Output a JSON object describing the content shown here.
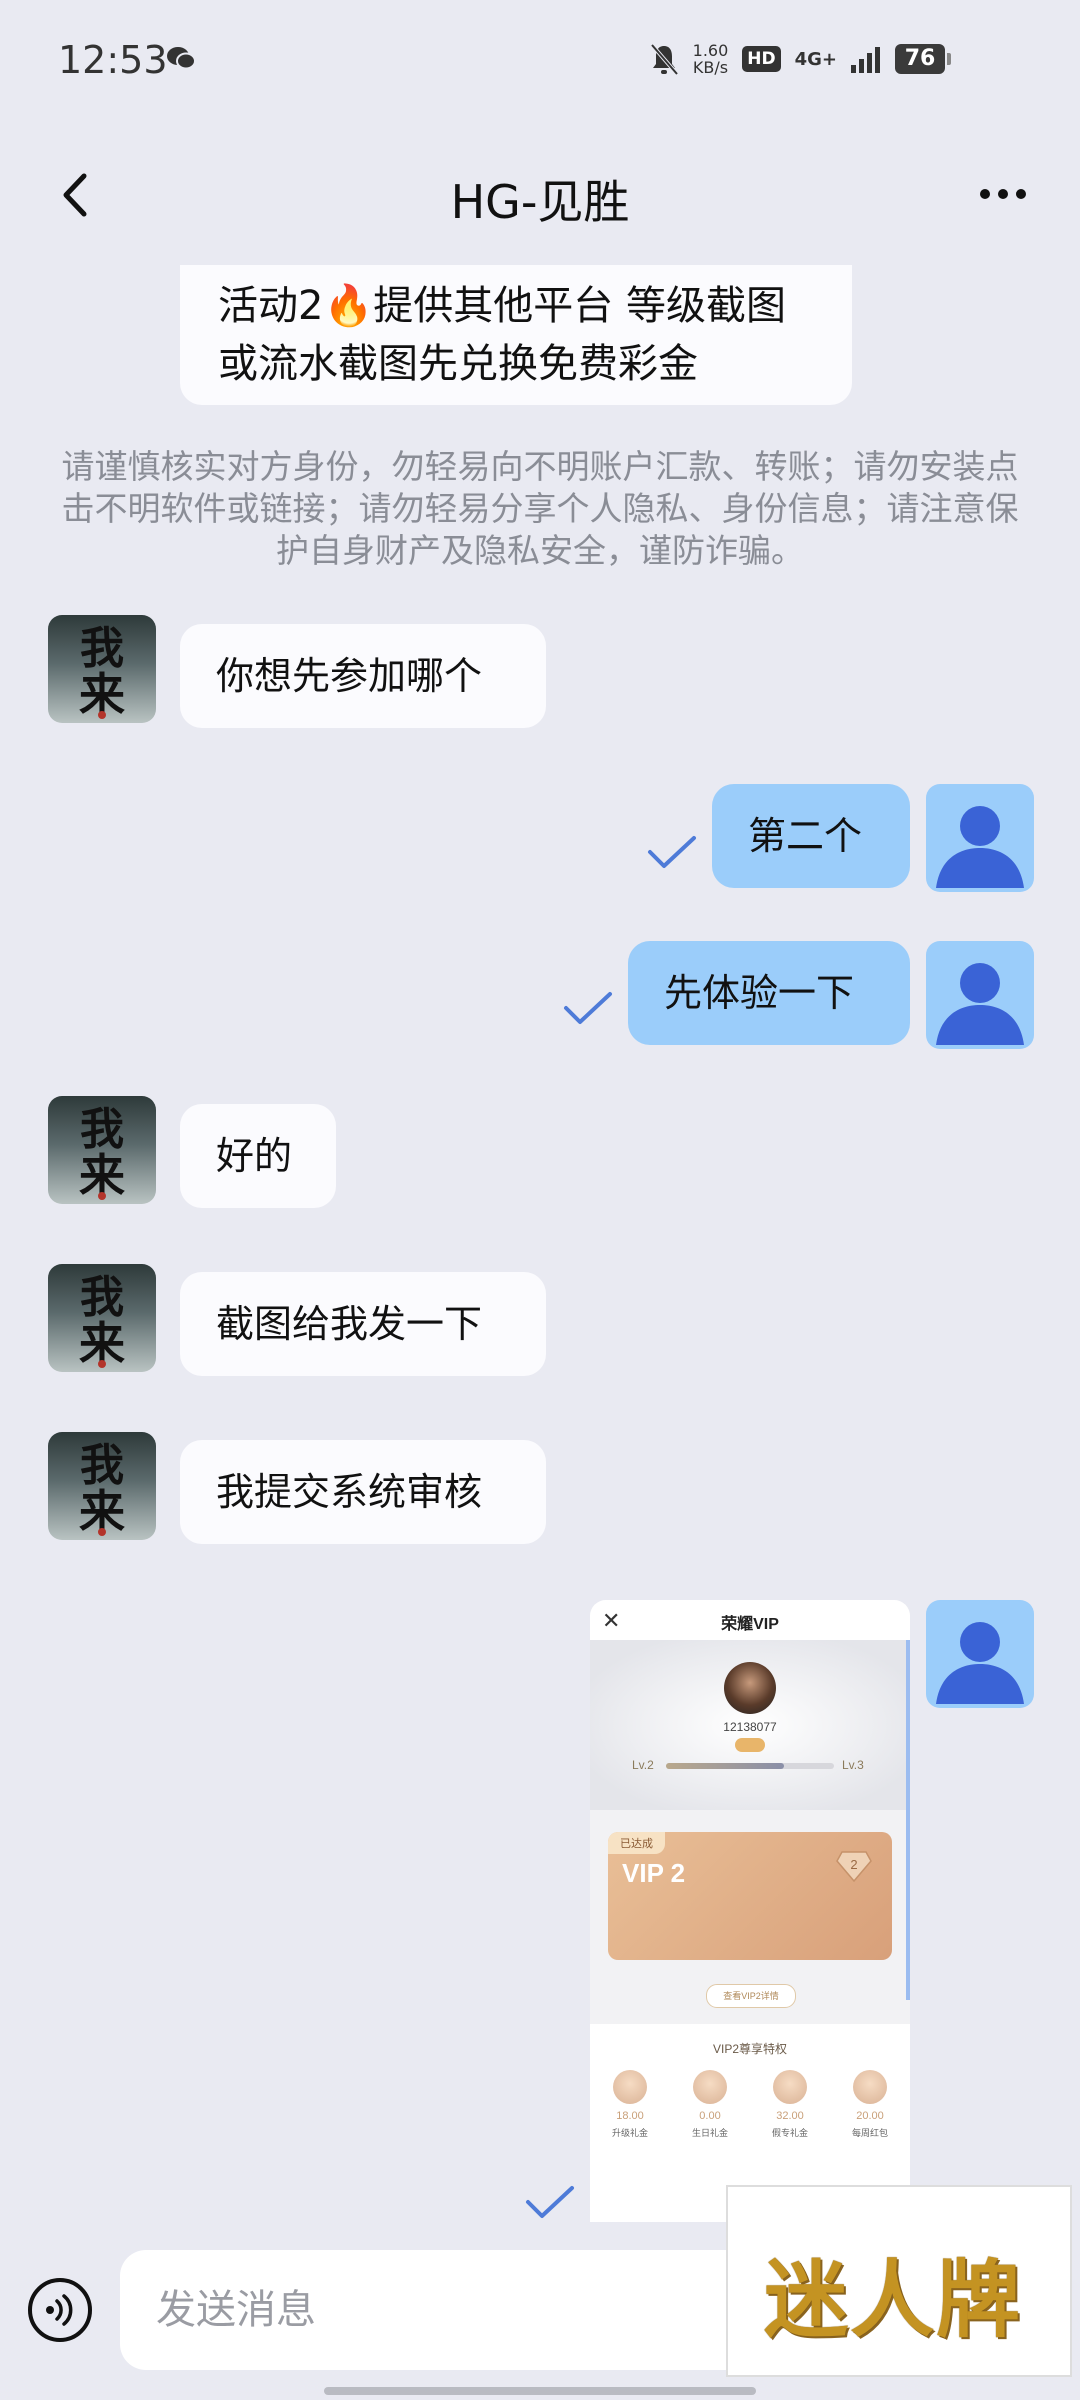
{
  "status_bar": {
    "time": "12:53",
    "speed_value": "1.60",
    "speed_unit": "KB/s",
    "hd_label": "HD",
    "network_label": "4G+",
    "battery": "76"
  },
  "header": {
    "title": "HG-见胜"
  },
  "messages": {
    "top_partial": "活动2🔥提供其他平台 等级截图或流水截图先兑换免费彩金",
    "notice": "请谨慎核实对方身份，勿轻易向不明账户汇款、转账；请勿安装点击不明软件或链接；请勿轻易分享个人隐私、身份信息；请注意保护自身财产及隐私安全，谨防诈骗。",
    "m1": "你想先参加哪个",
    "m2": "第二个",
    "m3": "先体验一下",
    "m4": "好的",
    "m5": "截图给我发一下",
    "m6": "我提交系统审核"
  },
  "avatar_text": "我来",
  "screenshot": {
    "close": "✕",
    "title": "荣耀VIP",
    "user_id": "12138077",
    "lv_left": "Lv.2",
    "lv_right": "Lv.3",
    "achieved": "已达成",
    "vip_name": "VIP 2",
    "vip_level": "2",
    "detail_button": "查看VIP2详情",
    "privilege_title": "VIP2尊享特权",
    "items": [
      {
        "value": "18.00",
        "label": "升级礼金"
      },
      {
        "value": "0.00",
        "label": "生日礼金"
      },
      {
        "value": "32.00",
        "label": "假专礼金"
      },
      {
        "value": "20.00",
        "label": "每周红包"
      }
    ]
  },
  "composer": {
    "placeholder": "发送消息"
  },
  "watermark": "迷人牌"
}
